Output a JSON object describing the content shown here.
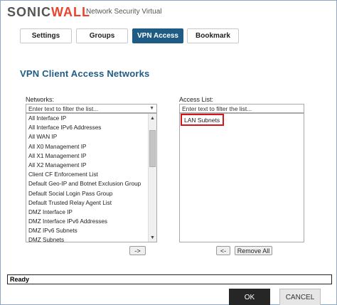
{
  "header": {
    "logo_text_1": "SONIC",
    "logo_text_2": "WALL",
    "product_title": "Network Security Virtual"
  },
  "tabs": [
    {
      "label": "Settings",
      "active": false
    },
    {
      "label": "Groups",
      "active": false
    },
    {
      "label": "VPN Access",
      "active": true
    },
    {
      "label": "Bookmark",
      "active": false
    }
  ],
  "panel_title": "VPN Client Access Networks",
  "networks": {
    "label": "Networks:",
    "filter_placeholder": "Enter text to filter the list...",
    "items": [
      "All Interface IP",
      "All Interface IPv6 Addresses",
      "All WAN IP",
      "All X0 Management IP",
      "All X1 Management IP",
      "All X2 Management IP",
      "Client CF Enforcement List",
      "Default Geo-IP and Botnet Exclusion Group",
      "Default Social Login Pass Group",
      "Default Trusted Relay Agent List",
      "DMZ Interface IP",
      "DMZ Interface IPv6 Addresses",
      "DMZ IPv6 Subnets",
      "DMZ Subnets"
    ]
  },
  "access_list": {
    "label": "Access List:",
    "filter_placeholder": "Enter text to filter the list...",
    "items": [
      "LAN Subnets"
    ]
  },
  "buttons": {
    "add": "->",
    "remove": "<-",
    "remove_all": "Remove All",
    "ok": "OK",
    "cancel": "CANCEL"
  },
  "status": "Ready",
  "colors": {
    "accent": "#1f5c85",
    "highlight_border": "#d7141a",
    "logo_accent": "#e8452c"
  }
}
